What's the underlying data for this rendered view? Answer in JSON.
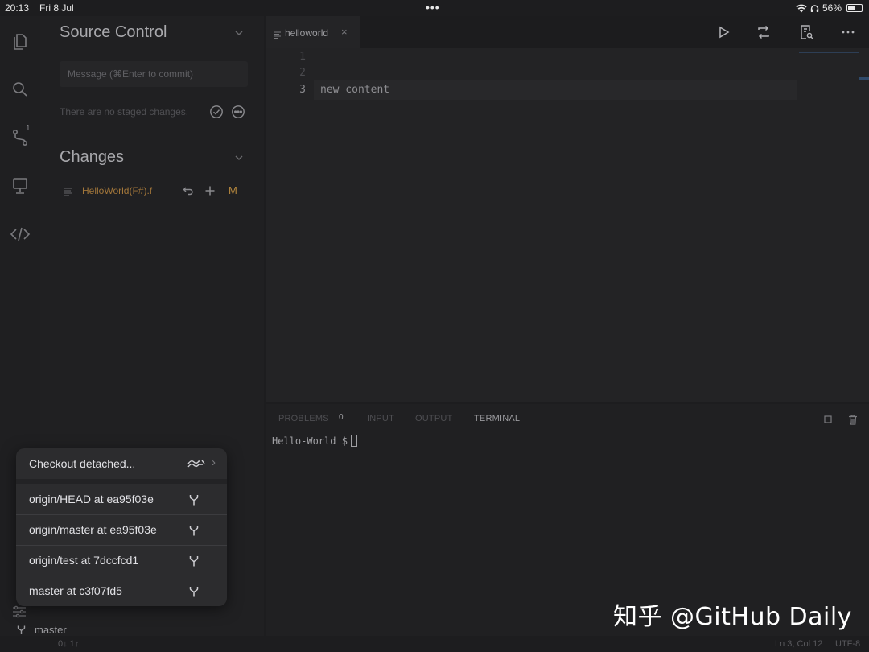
{
  "status_bar": {
    "time": "20:13",
    "date": "Fri 8 Jul",
    "battery_percent": "56%",
    "battery_level": 0.56
  },
  "activity_bar": {
    "icons": [
      "explorer-icon",
      "search-icon",
      "source-control-icon",
      "remote-icon",
      "code-icon"
    ],
    "source_control_badge": "1"
  },
  "source_control": {
    "title": "Source Control",
    "message_placeholder": "Message (⌘Enter to commit)",
    "no_staged_text": "There are no staged changes.",
    "changes_title": "Changes",
    "changed_files": [
      {
        "name": "HelloWorld(F#).f",
        "status": "M"
      }
    ]
  },
  "editor": {
    "tab_label": "helloworld",
    "line_numbers": [
      "1",
      "2",
      "3"
    ],
    "current_line": "new content"
  },
  "panel": {
    "tabs": [
      "PROBLEMS",
      "INPUT",
      "OUTPUT",
      "TERMINAL"
    ],
    "problems_count": "0",
    "active_tab": "TERMINAL",
    "prompt": "Hello-World $"
  },
  "branch_menu": {
    "checkout_detached": "Checkout detached...",
    "branches": [
      "origin/HEAD at ea95f03e",
      "origin/master at ea95f03e",
      "origin/test at 7dccfcd1",
      "master at c3f07fd5"
    ]
  },
  "bottom_status": {
    "branch": "master",
    "sync": "0↓ 1↑",
    "cursor_position": "Ln 3, Col 12",
    "encoding": "UTF-8"
  },
  "watermark": "知乎 @GitHub Daily",
  "colors": {
    "modified": "#b5873d",
    "background": "#1d1d1f",
    "popup": "#2c2c2e"
  }
}
